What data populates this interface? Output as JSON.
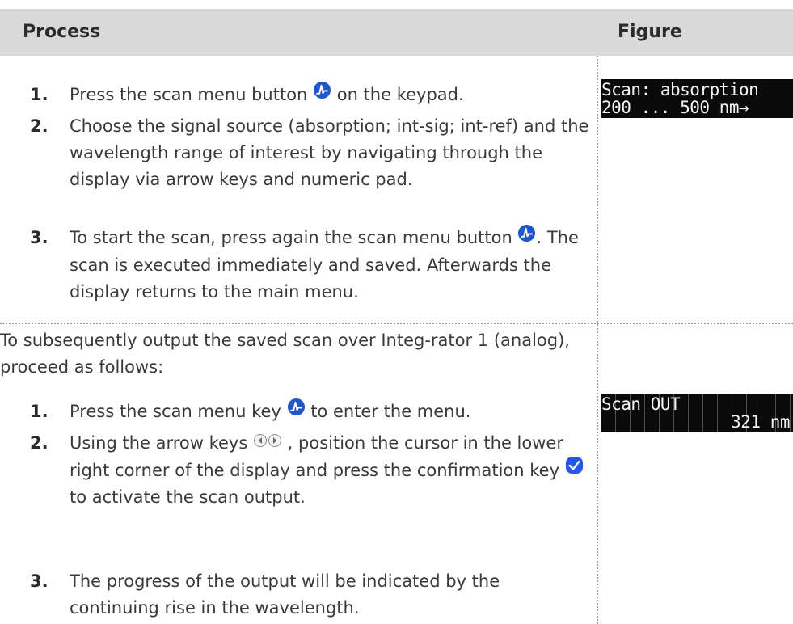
{
  "header": {
    "process": "Process",
    "figure": "Figure"
  },
  "section1": {
    "steps": [
      {
        "num": "1.",
        "before": "Press the scan menu button ",
        "after": " on the keypad."
      },
      {
        "num": "2.",
        "text": "Choose the signal source (absorption; int-sig; int-ref) and the wavelength range of interest by navigating through the display via arrow keys and numeric pad."
      },
      {
        "num": "3.",
        "before": "To start the scan, press again the scan menu button ",
        "after": ". The scan is executed immediately and saved. Afterwards the display returns to the main menu."
      }
    ],
    "display": {
      "line1": "Scan: absorption",
      "line2": "200 ... 500 nm→"
    }
  },
  "section2": {
    "intro": "To subsequently output the saved scan over Integ-rator 1 (analog), proceed as follows:",
    "steps": [
      {
        "num": "1.",
        "before": "Press the scan menu key ",
        "after": " to enter the menu."
      },
      {
        "num": "2.",
        "before": "Using the arrow keys ",
        "middle": " , position the cursor in the lower right corner of the display and press the confirmation key ",
        "after": " to activate the scan output."
      },
      {
        "num": "3.",
        "text": "The progress of the output will be indicated by the continuing rise in the wavelength."
      }
    ],
    "display": {
      "line1": "Scan OUT",
      "line2": "321 nm"
    }
  },
  "icons": {
    "scan": "scan-menu-icon",
    "arrows": "arrow-keys-icon",
    "confirm": "confirm-icon"
  },
  "colors": {
    "header_bg": "#d9d9d9",
    "scan_icon": "#1f56c8",
    "confirm_icon": "#2456e8",
    "lcd_bg": "#0a0a0a"
  }
}
